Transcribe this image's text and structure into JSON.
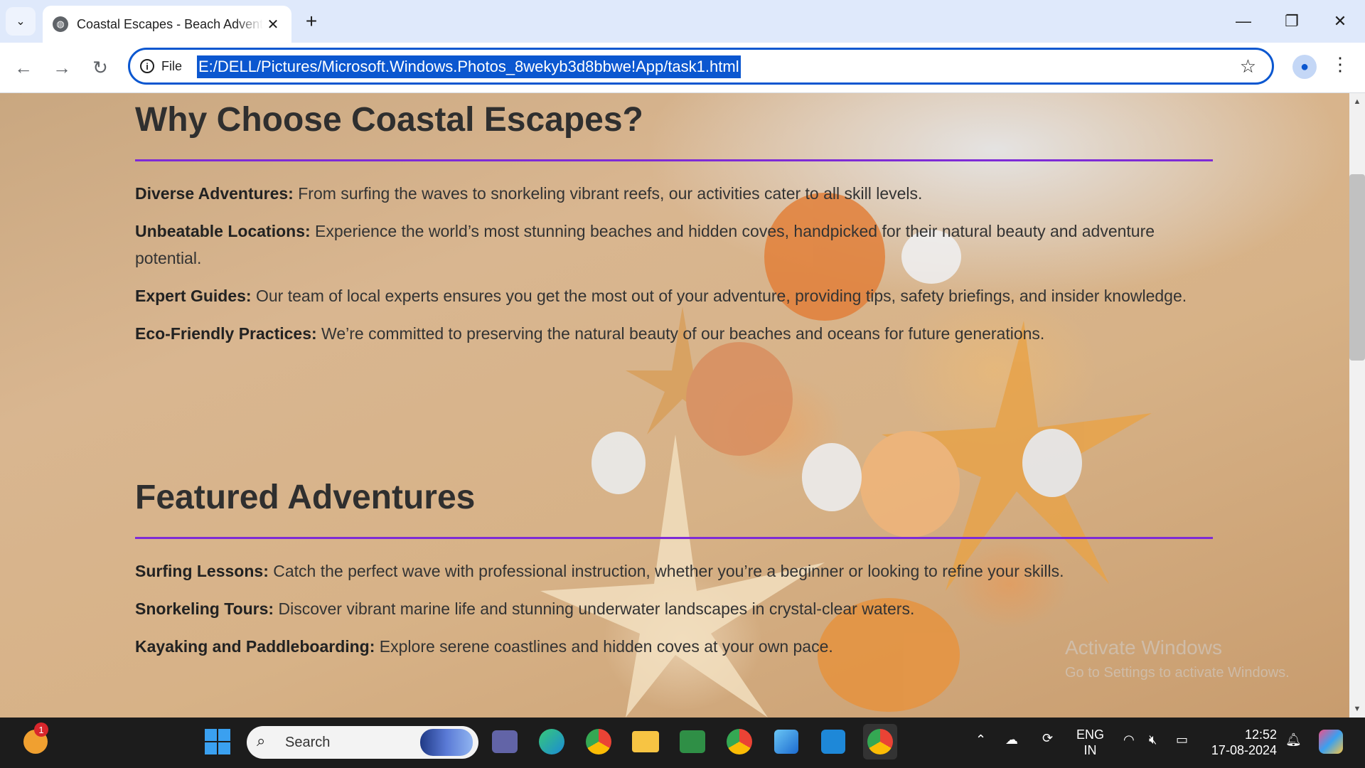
{
  "browser": {
    "tab_title": "Coastal Escapes - Beach Adventures",
    "file_label": "File",
    "url": "E:/DELL/Pictures/Microsoft.Windows.Photos_8wekyb3d8bbwe!App/task1.html"
  },
  "sections": [
    {
      "heading": "Why Choose Coastal Escapes?",
      "items": [
        {
          "term": "Diverse Adventures:",
          "text": " From surfing the waves to snorkeling vibrant reefs, our activities cater to all skill levels."
        },
        {
          "term": "Unbeatable Locations:",
          "text": " Experience the world’s most stunning beaches and hidden coves, handpicked for their natural beauty and adventure potential."
        },
        {
          "term": "Expert Guides:",
          "text": " Our team of local experts ensures you get the most out of your adventure, providing tips, safety briefings, and insider knowledge."
        },
        {
          "term": "Eco-Friendly Practices:",
          "text": " We’re committed to preserving the natural beauty of our beaches and oceans for future generations."
        }
      ]
    },
    {
      "heading": "Featured Adventures",
      "items": [
        {
          "term": "Surfing Lessons:",
          "text": " Catch the perfect wave with professional instruction, whether you’re a beginner or looking to refine your skills."
        },
        {
          "term": "Snorkeling Tours:",
          "text": " Discover vibrant marine life and stunning underwater landscapes in crystal-clear waters."
        },
        {
          "term": "Kayaking and Paddleboarding:",
          "text": " Explore serene coastlines and hidden coves at your own pace."
        }
      ]
    }
  ],
  "watermark": {
    "title": "Activate Windows",
    "subtitle": "Go to Settings to activate Windows."
  },
  "taskbar": {
    "search_placeholder": "Search",
    "notification_count": "1",
    "language": "ENG",
    "region": "IN",
    "time": "12:52",
    "date": "17-08-2024"
  },
  "colors": {
    "accent_rule": "#7e2bd6",
    "url_highlight": "#0b57d0"
  }
}
